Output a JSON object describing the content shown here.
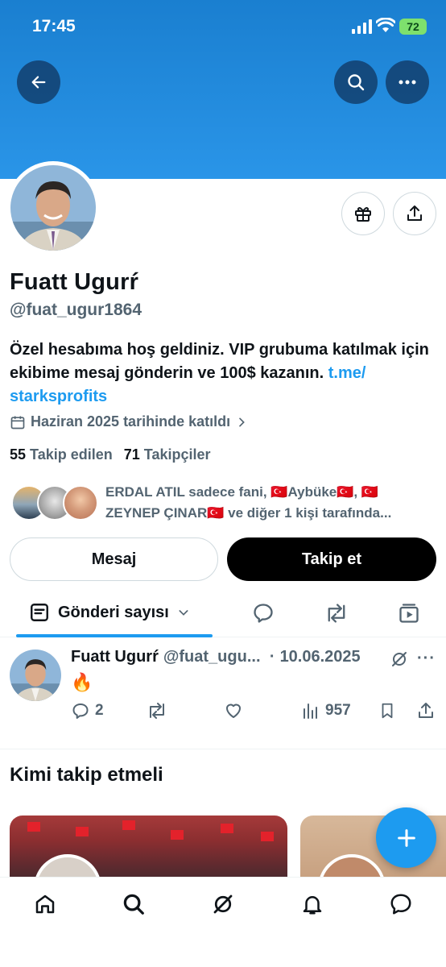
{
  "status_bar": {
    "time": "17:45",
    "battery": "72"
  },
  "profile": {
    "name": "Fuatt Ugurŕ",
    "handle": "@fuat_ugur1864",
    "bio_text": "Özel hesabıma hoş geldiniz. VIP grubuma katılmak için ekibime mesaj gönderin ve 100$ kazanın. ",
    "bio_link": "t.me/ starksprofits",
    "joined": "Haziran 2025 tarihinde katıldı",
    "following_count": "55",
    "following_label": "Takip edilen",
    "followers_count": "71",
    "followers_label": "Takipçiler",
    "followed_by_line1": "ERDAL ATIL sadece fani, 🇹🇷Aybüke🇹🇷, 🇹🇷",
    "followed_by_line2": "ZEYNEP ÇINAR🇹🇷 ve diğer 1 kişi tarafında..."
  },
  "buttons": {
    "message": "Mesaj",
    "follow": "Takip et"
  },
  "tabs": {
    "posts_label": "Gönderi sayısı"
  },
  "post": {
    "name": "Fuatt Ugurŕ",
    "handle": "@fuat_ugu...",
    "separator": "·",
    "date": "10.06.2025",
    "content": "🔥",
    "replies": "2",
    "views": "957"
  },
  "who_to_follow": {
    "title": "Kimi takip etmeli"
  },
  "colors": {
    "accent": "#1d9bf0",
    "banner": "#2a95e8",
    "text": "#0f1419",
    "secondary": "#536471"
  },
  "icons": [
    "back-arrow-icon",
    "search-icon",
    "more-icon",
    "gift-icon",
    "share-icon",
    "calendar-icon",
    "chevron-right-icon",
    "posts-icon",
    "chevron-down-icon",
    "reply-icon",
    "repost-icon",
    "media-icon",
    "grok-icon",
    "like-icon",
    "views-icon",
    "bookmark-icon",
    "plus-icon",
    "home-icon",
    "bell-icon",
    "messages-icon"
  ]
}
